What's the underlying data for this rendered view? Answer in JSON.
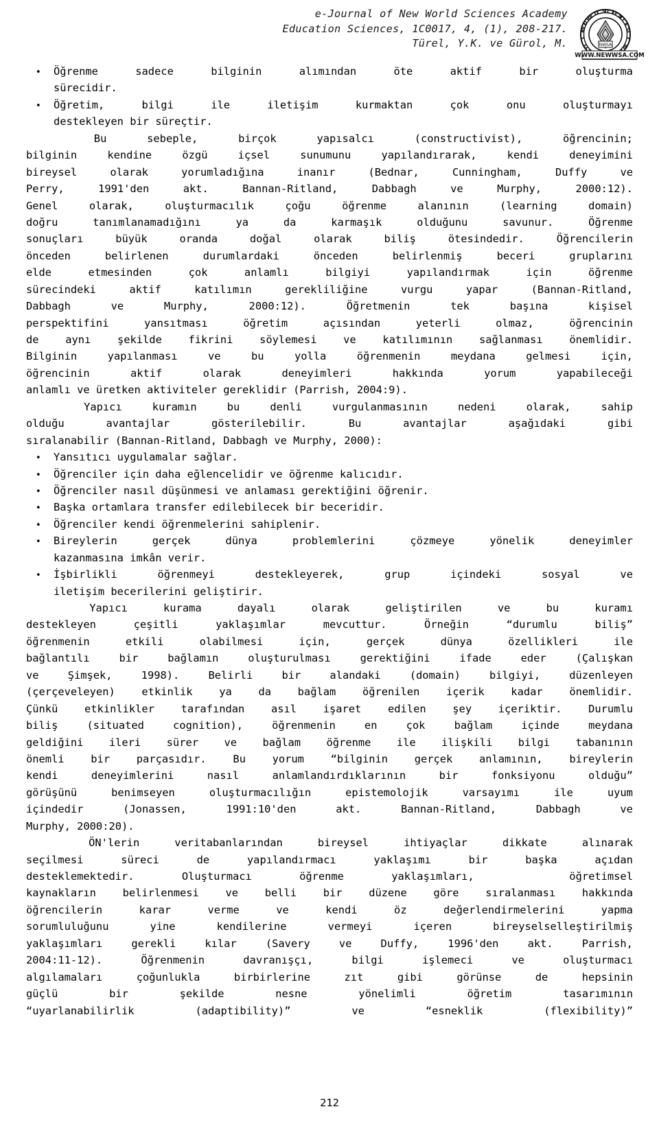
{
  "header": {
    "line1": "e-Journal of New World Sciences Academy",
    "line2": "Education Sciences, 1C0017, 4, (1), 208-217.",
    "line3": "Türel, Y.K. ve Gürol, M.",
    "logo": {
      "name": "new-world-sciences-academy-seal",
      "ring_text_top": "WORLD SCIENCES",
      "ring_text_bottom": "NEW ACADEMY",
      "center_text": "NWSA",
      "url_band": "WWW.NEWWSA.COM"
    }
  },
  "body": {
    "bullet_glyph": "•",
    "blocks": [
      {
        "kind": "bullet",
        "lines": [
          {
            "align": "just",
            "words": [
              "Öğrenme",
              "sadece",
              "bilginin",
              "alımından",
              "öte",
              "aktif",
              "bir",
              "oluşturma"
            ]
          },
          {
            "align": "flush",
            "words": [
              "sürecidir."
            ]
          }
        ]
      },
      {
        "kind": "bullet",
        "lines": [
          {
            "align": "just",
            "words": [
              "Öğretim,",
              "bilgi",
              "ile",
              "iletişim",
              "kurmaktan",
              "çok",
              "onu",
              "oluşturmayı"
            ]
          },
          {
            "align": "flush",
            "words": [
              "destekleyen bir süreçtir."
            ]
          }
        ]
      },
      {
        "kind": "para",
        "lines": [
          {
            "align": "just",
            "indent": true,
            "words": [
              "Bu",
              "sebeple,",
              "birçok",
              "yapısalcı",
              "(constructivist),",
              "öğrencinin;"
            ]
          },
          {
            "align": "just",
            "words": [
              "bilginin",
              "kendine",
              "özgü",
              "içsel",
              "sunumunu",
              "yapılandırarak,",
              "kendi",
              "deneyimini"
            ]
          },
          {
            "align": "just",
            "words": [
              "bireysel",
              "olarak",
              "yorumladığına",
              "inanır",
              "(Bednar,",
              "Cunningham,",
              "Duffy",
              "ve"
            ]
          },
          {
            "align": "just",
            "words": [
              "Perry,",
              "1991'den",
              "akt.",
              "Bannan-Ritland,",
              "Dabbagh",
              "ve",
              "Murphy,",
              "2000:12)."
            ]
          },
          {
            "align": "just",
            "words": [
              "Genel",
              "olarak,",
              "oluşturmacılık",
              "çoğu",
              "öğrenme",
              "alanının",
              "(learning",
              "domain)"
            ]
          },
          {
            "align": "just",
            "words": [
              "doğru",
              "tanımlanamadığını",
              "ya",
              "da",
              "karmaşık",
              "olduğunu",
              "savunur.",
              "Öğrenme"
            ]
          },
          {
            "align": "just",
            "words": [
              "sonuçları",
              "büyük",
              "oranda",
              "doğal",
              "olarak",
              "biliş",
              "ötesindedir.",
              "Öğrencilerin"
            ]
          },
          {
            "align": "just",
            "words": [
              "önceden",
              "belirlenen",
              "durumlardaki",
              "önceden",
              "belirlenmiş",
              "beceri",
              "gruplarını"
            ]
          },
          {
            "align": "just",
            "words": [
              "elde",
              "etmesinden",
              "çok",
              "anlamlı",
              "bilgiyi",
              "yapılandırmak",
              "için",
              "öğrenme"
            ]
          },
          {
            "align": "just",
            "words": [
              "sürecindeki",
              "aktif",
              "katılımın",
              "gerekliliğine",
              "vurgu",
              "yapar",
              "(Bannan-Ritland,"
            ]
          },
          {
            "align": "just",
            "words": [
              "Dabbagh",
              "ve",
              "Murphy,",
              "2000:12).",
              "Öğretmenin",
              "tek",
              "başına",
              "kişisel"
            ]
          },
          {
            "align": "just",
            "words": [
              "perspektifini",
              "yansıtması",
              "öğretim",
              "açısından",
              "yeterli",
              "olmaz,",
              "öğrencinin"
            ]
          },
          {
            "align": "just",
            "words": [
              "de",
              "aynı",
              "şekilde",
              "fikrini",
              "söylemesi",
              "ve",
              "katılımının",
              "sağlanması",
              "önemlidir."
            ]
          },
          {
            "align": "just",
            "words": [
              "Bilginin",
              "yapılanması",
              "ve",
              "bu",
              "yolla",
              "öğrenmenin",
              "meydana",
              "gelmesi",
              "için,"
            ]
          },
          {
            "align": "just",
            "words": [
              "öğrencinin",
              "aktif",
              "olarak",
              "deneyimleri",
              "hakkında",
              "yorum",
              "yapabileceği"
            ]
          },
          {
            "align": "flush",
            "words": [
              "anlamlı ve üretken aktiviteler gereklidir (Parrish, 2004:9)."
            ]
          }
        ]
      },
      {
        "kind": "para",
        "lines": [
          {
            "align": "just",
            "indent": true,
            "words": [
              "Yapıcı",
              "kuramın",
              "bu",
              "denli",
              "vurgulanmasının",
              "nedeni",
              "olarak,",
              "sahip"
            ]
          },
          {
            "align": "just",
            "words": [
              "olduğu",
              "avantajlar",
              "gösterilebilir.",
              "Bu",
              "avantajlar",
              "aşağıdaki",
              "gibi"
            ]
          },
          {
            "align": "flush",
            "words": [
              "sıralanabilir (Bannan-Ritland, Dabbagh ve Murphy, 2000):"
            ]
          }
        ]
      },
      {
        "kind": "bullet",
        "lines": [
          {
            "align": "flush",
            "words": [
              "Yansıtıcı uygulamalar sağlar."
            ]
          }
        ]
      },
      {
        "kind": "bullet",
        "lines": [
          {
            "align": "flush",
            "words": [
              "Öğrenciler için daha eğlencelidir ve öğrenme kalıcıdır."
            ]
          }
        ]
      },
      {
        "kind": "bullet",
        "lines": [
          {
            "align": "flush",
            "words": [
              "Öğrenciler nasıl düşünmesi ve anlaması gerektiğini öğrenir."
            ]
          }
        ]
      },
      {
        "kind": "bullet",
        "lines": [
          {
            "align": "flush",
            "words": [
              "Başka ortamlara transfer edilebilecek bir beceridir."
            ]
          }
        ]
      },
      {
        "kind": "bullet",
        "lines": [
          {
            "align": "flush",
            "words": [
              "Öğrenciler kendi öğrenmelerini sahiplenir."
            ]
          }
        ]
      },
      {
        "kind": "bullet",
        "lines": [
          {
            "align": "just",
            "words": [
              "Bireylerin",
              "gerçek",
              "dünya",
              "problemlerini",
              "çözmeye",
              "yönelik",
              "deneyimler"
            ]
          },
          {
            "align": "flush",
            "words": [
              "kazanmasına imkân verir."
            ]
          }
        ]
      },
      {
        "kind": "bullet",
        "lines": [
          {
            "align": "just",
            "words": [
              "İşbirlikli",
              "öğrenmeyi",
              "destekleyerek,",
              "grup",
              "içindeki",
              "sosyal",
              "ve"
            ]
          },
          {
            "align": "flush",
            "words": [
              "iletişim becerilerini geliştirir."
            ]
          }
        ]
      },
      {
        "kind": "para",
        "lines": [
          {
            "align": "just",
            "indent": true,
            "words": [
              "Yapıcı",
              "kurama",
              "dayalı",
              "olarak",
              "geliştirilen",
              "ve",
              "bu",
              "kuramı"
            ]
          },
          {
            "align": "just",
            "words": [
              "destekleyen",
              "çeşitli",
              "yaklaşımlar",
              "mevcuttur.",
              "Örneğin",
              "“durumlu",
              "biliş”"
            ]
          },
          {
            "align": "just",
            "words": [
              "öğrenmenin",
              "etkili",
              "olabilmesi",
              "için,",
              "gerçek",
              "dünya",
              "özellikleri",
              "ile"
            ]
          },
          {
            "align": "just",
            "words": [
              "bağlantılı",
              "bir",
              "bağlamın",
              "oluşturulması",
              "gerektiğini",
              "ifade",
              "eder",
              "(Çalışkan"
            ]
          },
          {
            "align": "just",
            "words": [
              "ve",
              "Şimşek,",
              "1998).",
              "Belirli",
              "bir",
              "alandaki",
              "(domain)",
              "bilgiyi,",
              "düzenleyen"
            ]
          },
          {
            "align": "just",
            "words": [
              "(çerçeveleyen)",
              "etkinlik",
              "ya",
              "da",
              "bağlam",
              "öğrenilen",
              "içerik",
              "kadar",
              "önemlidir."
            ]
          },
          {
            "align": "just",
            "words": [
              "Çünkü",
              "etkinlikler",
              "tarafından",
              "asıl",
              "işaret",
              "edilen",
              "şey",
              "içeriktir.",
              "Durumlu"
            ]
          },
          {
            "align": "just",
            "words": [
              "biliş",
              "(situated",
              "cognition),",
              "öğrenmenin",
              "en",
              "çok",
              "bağlam",
              "içinde",
              "meydana"
            ]
          },
          {
            "align": "just",
            "words": [
              "geldiğini",
              "ileri",
              "sürer",
              "ve",
              "bağlam",
              "öğrenme",
              "ile",
              "ilişkili",
              "bilgi",
              "tabanının"
            ]
          },
          {
            "align": "just",
            "words": [
              "önemli",
              "bir",
              "parçasıdır.",
              "Bu",
              "yorum",
              "“bilginin",
              "gerçek",
              "anlamının,",
              "bireylerin"
            ]
          },
          {
            "align": "just",
            "words": [
              "kendi",
              "deneyimlerini",
              "nasıl",
              "anlamlandırdıklarının",
              "bir",
              "fonksiyonu",
              "olduğu”"
            ]
          },
          {
            "align": "just",
            "words": [
              "görüşünü",
              "benimseyen",
              "oluşturmacılığın",
              "epistemolojik",
              "varsayımı",
              "ile",
              "uyum"
            ]
          },
          {
            "align": "just",
            "words": [
              "içindedir",
              "(Jonassen,",
              "1991:10'den",
              "akt.",
              "Bannan-Ritland,",
              "Dabbagh",
              "ve"
            ]
          },
          {
            "align": "flush",
            "words": [
              "Murphy, 2000:20)."
            ]
          }
        ]
      },
      {
        "kind": "para",
        "lines": [
          {
            "align": "just",
            "indent": true,
            "words": [
              "ÖN'lerin",
              "veritabanlarından",
              "bireysel",
              "ihtiyaçlar",
              "dikkate",
              "alınarak"
            ]
          },
          {
            "align": "just",
            "words": [
              "seçilmesi",
              "süreci",
              "de",
              "yapılandırmacı",
              "yaklaşımı",
              "bir",
              "başka",
              "açıdan"
            ]
          },
          {
            "align": "just",
            "words": [
              "desteklemektedir.",
              "Oluşturmacı",
              "öğrenme",
              "yaklaşımları,",
              "",
              "öğretimsel"
            ]
          },
          {
            "align": "just",
            "words": [
              "kaynakların",
              "belirlenmesi",
              "ve",
              "belli",
              "bir",
              "düzene",
              "göre",
              "sıralanması",
              "hakkında"
            ]
          },
          {
            "align": "just",
            "words": [
              "öğrencilerin",
              "karar",
              "verme",
              "ve",
              "kendi",
              "öz",
              "değerlendirmelerini",
              "yapma"
            ]
          },
          {
            "align": "just",
            "words": [
              "sorumluluğunu",
              "yine",
              "kendilerine",
              "vermeyi",
              "içeren",
              "bireyselselleştirilmiş"
            ]
          },
          {
            "align": "just",
            "words": [
              "yaklaşımları",
              "gerekli",
              "kılar",
              "(Savery",
              "ve",
              "Duffy,",
              "1996'den",
              "akt.",
              "Parrish,"
            ]
          },
          {
            "align": "just",
            "words": [
              "2004:11-12).",
              "Öğrenmenin",
              "davranışçı,",
              "bilgi",
              "işlemeci",
              "ve",
              "oluşturmacı"
            ]
          },
          {
            "align": "just",
            "words": [
              "algılamaları",
              "çoğunlukla",
              "birbirlerine",
              "zıt",
              "gibi",
              "görünse",
              "de",
              "hepsinin"
            ]
          },
          {
            "align": "just",
            "words": [
              "güçlü",
              "bir",
              "şekilde",
              "nesne",
              "yönelimli",
              "öğretim",
              "tasarımının"
            ]
          },
          {
            "align": "just",
            "words": [
              "“uyarlanabilirlik",
              "(adaptibility)”",
              "ve",
              "“esneklik",
              "(flexibility)”"
            ]
          }
        ]
      }
    ]
  },
  "footer": {
    "page_number": "212"
  },
  "colors": {
    "text": "#000000",
    "header_text": "#1a1a1a",
    "page_background": "#ffffff"
  }
}
